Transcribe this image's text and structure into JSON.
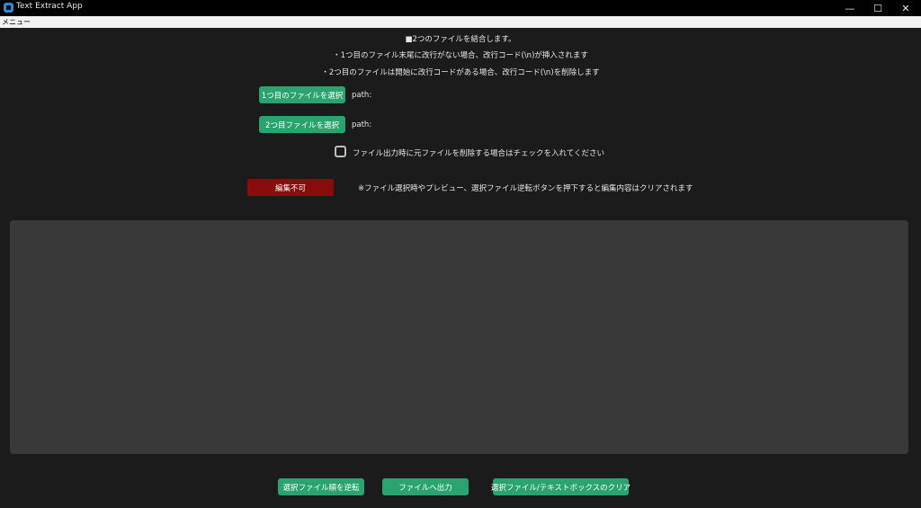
{
  "window": {
    "title": "Text Extract App",
    "controls": {
      "minimize": "—",
      "maximize": "☐",
      "close": "✕"
    }
  },
  "menubar": {
    "menu_label": "メニュー"
  },
  "info": {
    "line1": "■2つのファイルを結合します。",
    "line2": "・1つ目のファイル末尾に改行がない場合、改行コード(\\n)が挿入されます",
    "line3": "・2つ目のファイルは開始に改行コードがある場合、改行コード(\\n)を削除します"
  },
  "file1": {
    "button_label": "1つ目のファイルを選択",
    "path_label": "path:"
  },
  "file2": {
    "button_label": "2つ目ファイルを選択",
    "path_label": "path:"
  },
  "delete_option": {
    "label": "ファイル出力時に元ファイルを削除する場合はチェックを入れてください",
    "checked": false
  },
  "edit_toggle": {
    "label": "編集不可",
    "note": "※ファイル選択時やプレビュー、選択ファイル逆転ボタンを押下すると編集内容はクリアされます"
  },
  "textbox": {
    "value": ""
  },
  "footer": {
    "reverse_label": "選択ファイル順を逆転",
    "output_label": "ファイルへ出力",
    "clear_label": "選択ファイル/テキストボックスのクリア"
  },
  "colors": {
    "accent_green": "#2aa36e",
    "disabled_red": "#8a0b0b",
    "background": "#1b1b1b",
    "textbox": "#393939"
  }
}
